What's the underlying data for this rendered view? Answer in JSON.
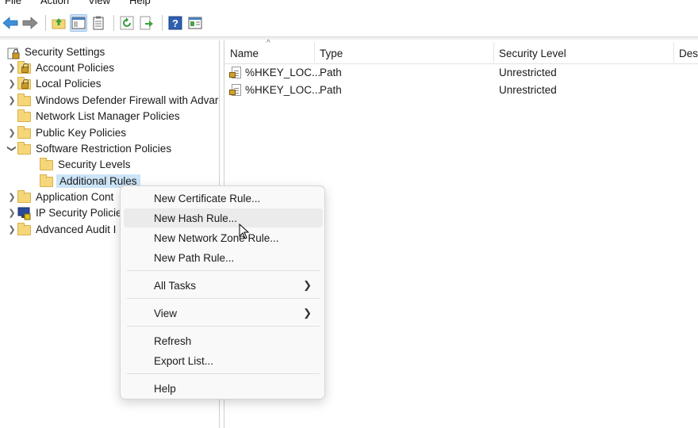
{
  "menubar": [
    "File",
    "Action",
    "View",
    "Help"
  ],
  "toolbar": {
    "buttons": [
      "back-icon",
      "forward-icon",
      "up-folder-icon",
      "show-hide-tree-icon",
      "clipboard-icon",
      "refresh-icon",
      "export-icon",
      "help-icon",
      "properties-icon"
    ]
  },
  "tree": {
    "root": "Security Settings",
    "items": [
      {
        "label": "Account Policies"
      },
      {
        "label": "Local Policies"
      },
      {
        "label": "Windows Defender Firewall with Advar"
      },
      {
        "label": "Network List Manager Policies"
      },
      {
        "label": "Public Key Policies"
      },
      {
        "label": "Software Restriction Policies"
      },
      {
        "label": "Security Levels"
      },
      {
        "label": "Additional Rules"
      },
      {
        "label": "Application Cont"
      },
      {
        "label": "IP Security Policie"
      },
      {
        "label": "Advanced Audit I"
      }
    ]
  },
  "list": {
    "columns": [
      "Name",
      "Type",
      "Security Level",
      "Des"
    ],
    "rows": [
      {
        "name": "%HKEY_LOC...",
        "type": "Path",
        "level": "Unrestricted"
      },
      {
        "name": "%HKEY_LOC...",
        "type": "Path",
        "level": "Unrestricted"
      }
    ]
  },
  "context_menu": {
    "items": [
      "New Certificate Rule...",
      "New Hash Rule...",
      "New Network Zone Rule...",
      "New Path Rule...",
      "All Tasks",
      "View",
      "Refresh",
      "Export List...",
      "Help"
    ]
  }
}
